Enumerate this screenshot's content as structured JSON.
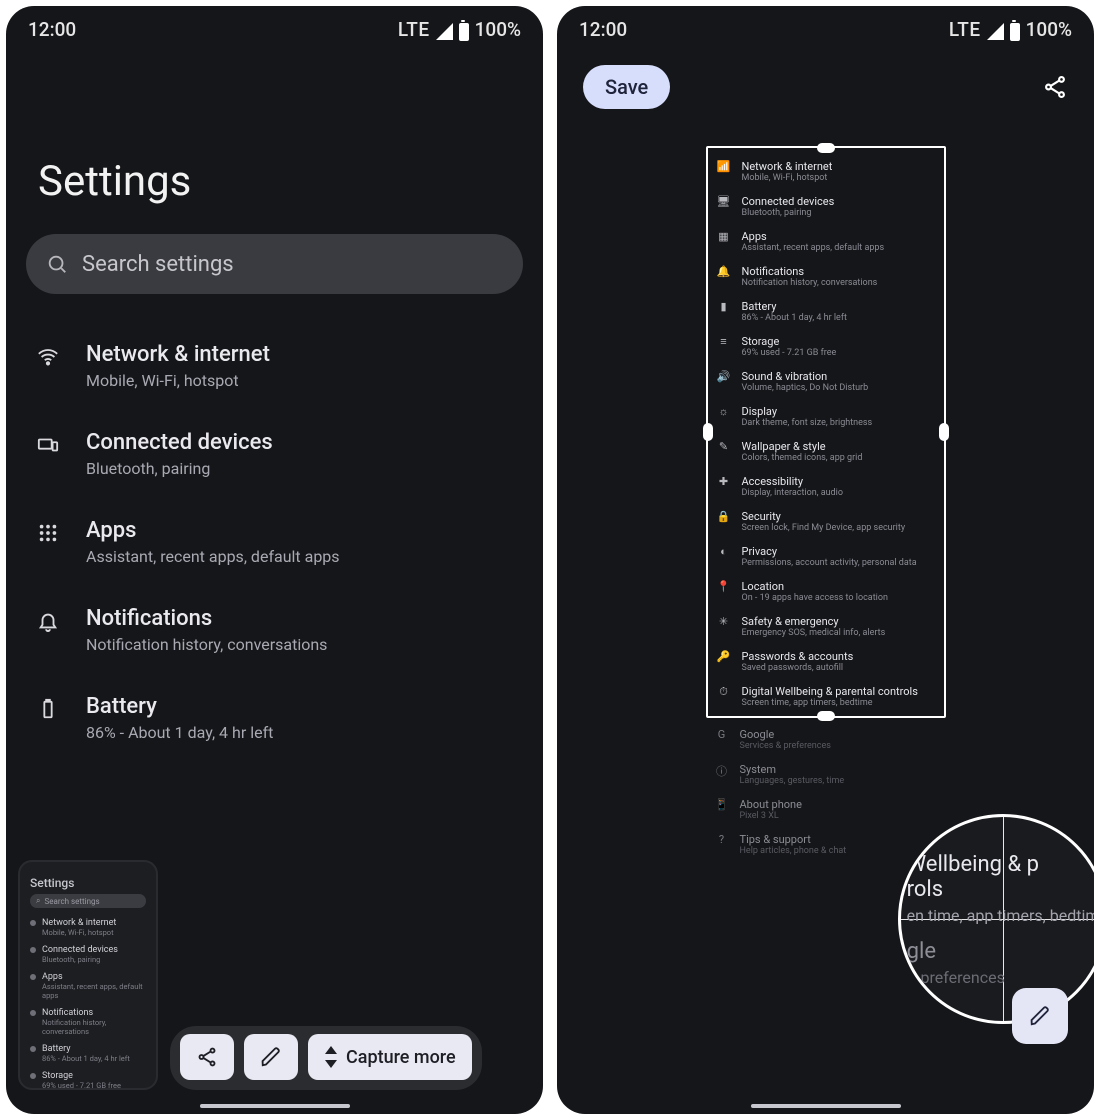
{
  "status": {
    "time": "12:00",
    "lte": "LTE",
    "battery": "100%"
  },
  "left": {
    "title": "Settings",
    "search_placeholder": "Search settings",
    "items": [
      {
        "icon": "wifi",
        "title": "Network & internet",
        "subtitle": "Mobile, Wi-Fi, hotspot"
      },
      {
        "icon": "devices",
        "title": "Connected devices",
        "subtitle": "Bluetooth, pairing"
      },
      {
        "icon": "apps",
        "title": "Apps",
        "subtitle": "Assistant, recent apps, default apps"
      },
      {
        "icon": "bell",
        "title": "Notifications",
        "subtitle": "Notification history, conversations"
      },
      {
        "icon": "battery",
        "title": "Battery",
        "subtitle": "86% - About 1 day, 4 hr left"
      }
    ],
    "thumbnail": {
      "title": "Settings",
      "search": "Search settings",
      "rows": [
        {
          "t1": "Network & internet",
          "t2": "Mobile, Wi-Fi, hotspot"
        },
        {
          "t1": "Connected devices",
          "t2": "Bluetooth, pairing"
        },
        {
          "t1": "Apps",
          "t2": "Assistant, recent apps, default apps"
        },
        {
          "t1": "Notifications",
          "t2": "Notification history, conversations"
        },
        {
          "t1": "Battery",
          "t2": "86% - About 1 day, 4 hr left"
        },
        {
          "t1": "Storage",
          "t2": "69% used - 7.21 GB free"
        }
      ]
    },
    "actions": {
      "capture_more": "Capture more"
    }
  },
  "right": {
    "save": "Save",
    "crop_items": [
      {
        "glyph": "📶",
        "title": "Network & internet",
        "subtitle": "Mobile, Wi-Fi, hotspot"
      },
      {
        "glyph": "🖥",
        "title": "Connected devices",
        "subtitle": "Bluetooth, pairing"
      },
      {
        "glyph": "▦",
        "title": "Apps",
        "subtitle": "Assistant, recent apps, default apps"
      },
      {
        "glyph": "🔔",
        "title": "Notifications",
        "subtitle": "Notification history, conversations"
      },
      {
        "glyph": "▮",
        "title": "Battery",
        "subtitle": "86% - About 1 day, 4 hr left"
      },
      {
        "glyph": "≡",
        "title": "Storage",
        "subtitle": "69% used - 7.21 GB free"
      },
      {
        "glyph": "🔊",
        "title": "Sound & vibration",
        "subtitle": "Volume, haptics, Do Not Disturb"
      },
      {
        "glyph": "☼",
        "title": "Display",
        "subtitle": "Dark theme, font size, brightness"
      },
      {
        "glyph": "✎",
        "title": "Wallpaper & style",
        "subtitle": "Colors, themed icons, app grid"
      },
      {
        "glyph": "✚",
        "title": "Accessibility",
        "subtitle": "Display, interaction, audio"
      },
      {
        "glyph": "🔒",
        "title": "Security",
        "subtitle": "Screen lock, Find My Device, app security"
      },
      {
        "glyph": "◐",
        "title": "Privacy",
        "subtitle": "Permissions, account activity, personal data"
      },
      {
        "glyph": "📍",
        "title": "Location",
        "subtitle": "On - 19 apps have access to location"
      },
      {
        "glyph": "✳",
        "title": "Safety & emergency",
        "subtitle": "Emergency SOS, medical info, alerts"
      },
      {
        "glyph": "🔑",
        "title": "Passwords & accounts",
        "subtitle": "Saved passwords, autofill"
      },
      {
        "glyph": "⏱",
        "title": "Digital Wellbeing & parental controls",
        "subtitle": "Screen time, app timers, bedtime"
      }
    ],
    "below_items": [
      {
        "glyph": "G",
        "title": "Google",
        "subtitle": "Services & preferences"
      },
      {
        "glyph": "ⓘ",
        "title": "System",
        "subtitle": "Languages, gestures, time"
      },
      {
        "glyph": "📱",
        "title": "About phone",
        "subtitle": "Pixel 3 XL"
      },
      {
        "glyph": "?",
        "title": "Tips & support",
        "subtitle": "Help articles, phone & chat"
      }
    ],
    "loupe": {
      "top": {
        "primary": "Wellbeing & p",
        "secondary_suffix": "rols",
        "tertiary": "en time, app timers, bedtim"
      },
      "bottom": {
        "primary": "gle",
        "secondary": "& preferences"
      }
    }
  }
}
